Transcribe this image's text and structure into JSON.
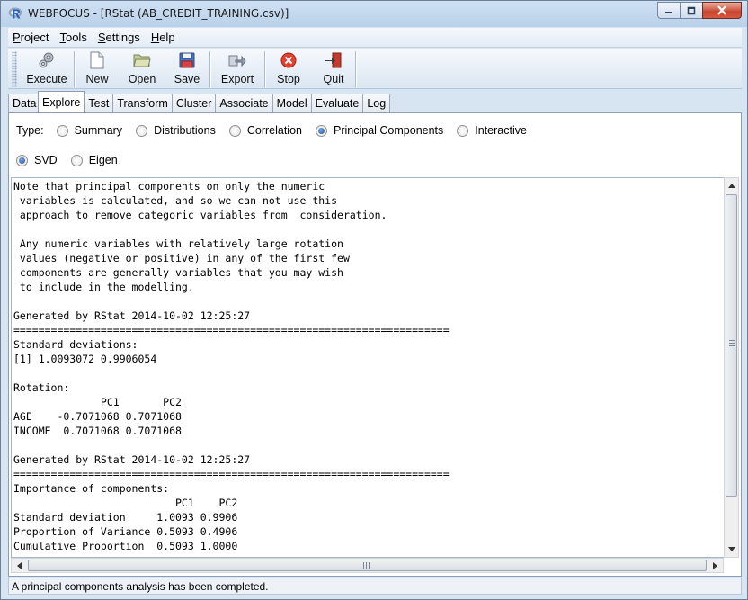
{
  "window": {
    "title": "WEBFOCUS - [RStat (AB_CREDIT_TRAINING.csv)]"
  },
  "menu": [
    {
      "label": "Project",
      "accel": "P",
      "rest": "roject"
    },
    {
      "label": "Tools",
      "accel": "T",
      "rest": "ools"
    },
    {
      "label": "Settings",
      "accel": "S",
      "rest": "ettings"
    },
    {
      "label": "Help",
      "accel": "H",
      "rest": "elp"
    }
  ],
  "toolbar": {
    "execute": "Execute",
    "new": "New",
    "open": "Open",
    "save": "Save",
    "export": "Export",
    "stop": "Stop",
    "quit": "Quit"
  },
  "tabs": [
    "Data",
    "Explore",
    "Test",
    "Transform",
    "Cluster",
    "Associate",
    "Model",
    "Evaluate",
    "Log"
  ],
  "active_tab": "Explore",
  "explore": {
    "type_label": "Type:",
    "type_options": [
      "Summary",
      "Distributions",
      "Correlation",
      "Principal Components",
      "Interactive"
    ],
    "type_selected": "Principal Components",
    "method_options": [
      "SVD",
      "Eigen"
    ],
    "method_selected": "SVD"
  },
  "output_text": "Note that principal components on only the numeric\n variables is calculated, and so we can not use this\n approach to remove categoric variables from  consideration.\n\n Any numeric variables with relatively large rotation\n values (negative or positive) in any of the first few\n components are generally variables that you may wish\n to include in the modelling.\n\nGenerated by RStat 2014-10-02 12:25:27\n======================================================================\nStandard deviations:\n[1] 1.0093072 0.9906054\n\nRotation:\n              PC1       PC2\nAGE    -0.7071068 0.7071068\nINCOME  0.7071068 0.7071068\n\nGenerated by RStat 2014-10-02 12:25:27\n======================================================================\nImportance of components:\n                          PC1    PC2\nStandard deviation     1.0093 0.9906\nProportion of Variance 0.5093 0.4906\nCumulative Proportion  0.5093 1.0000",
  "status": "A principal components analysis has been completed.",
  "colors": {
    "titlebar": "#c4d8ee",
    "close_button": "#c7452f",
    "radio_checked": "#1d4f9b"
  }
}
